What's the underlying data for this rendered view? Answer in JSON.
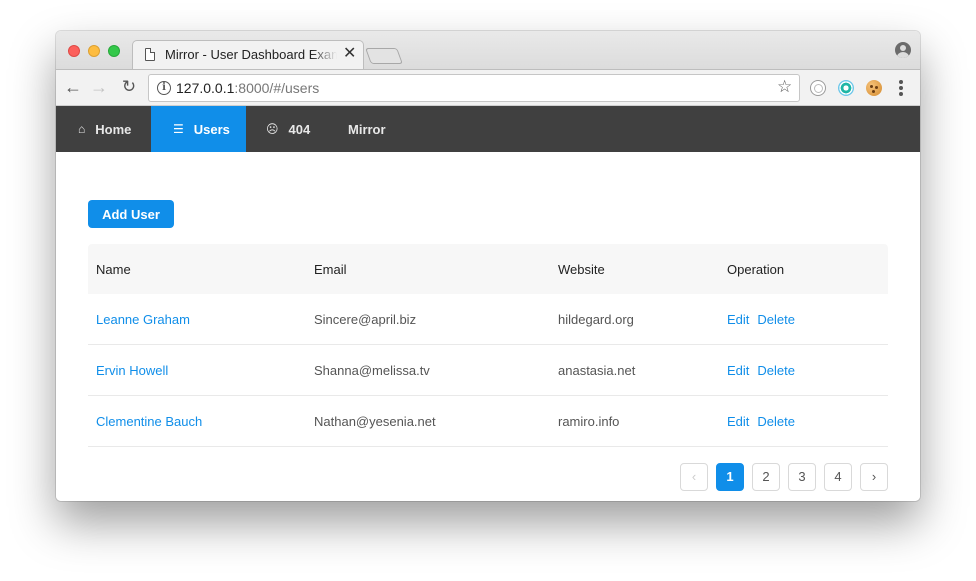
{
  "browser": {
    "tab_title": "Mirror - User Dashboard Example",
    "tab_close": "✕",
    "url_host": "127.0.0.1",
    "url_rest": ":8000/#/users",
    "back_glyph": "←",
    "forward_glyph": "→",
    "reload_glyph": "↻",
    "info_glyph": "i",
    "star_glyph": "☆",
    "icons": [
      "doc-icon",
      "back-icon",
      "forward-icon",
      "reload-icon",
      "info-icon",
      "star-icon",
      "extension-icon",
      "radar-extension-icon",
      "cookie-extension-icon",
      "menu-icon",
      "profile-icon"
    ]
  },
  "nav": {
    "items": [
      {
        "label": "Home",
        "icon": "⌂"
      },
      {
        "label": "Users",
        "icon": "☰"
      },
      {
        "label": "404",
        "icon": "☹"
      },
      {
        "label": "Mirror",
        "icon": ""
      }
    ],
    "active": "Users",
    "accent_color": "#108ee9",
    "bar_color": "#404040"
  },
  "main": {
    "add_button": "Add User",
    "table": {
      "headers": [
        "Name",
        "Email",
        "Website",
        "Operation"
      ],
      "rows": [
        {
          "name": "Leanne Graham",
          "email": "Sincere@april.biz",
          "website": "hildegard.org"
        },
        {
          "name": "Ervin Howell",
          "email": "Shanna@melissa.tv",
          "website": "anastasia.net"
        },
        {
          "name": "Clementine Bauch",
          "email": "Nathan@yesenia.net",
          "website": "ramiro.info"
        }
      ],
      "op_edit": "Edit",
      "op_delete": "Delete"
    },
    "pagination": {
      "prev": "‹",
      "pages": [
        "1",
        "2",
        "3",
        "4"
      ],
      "current": "1",
      "next": "›"
    }
  }
}
